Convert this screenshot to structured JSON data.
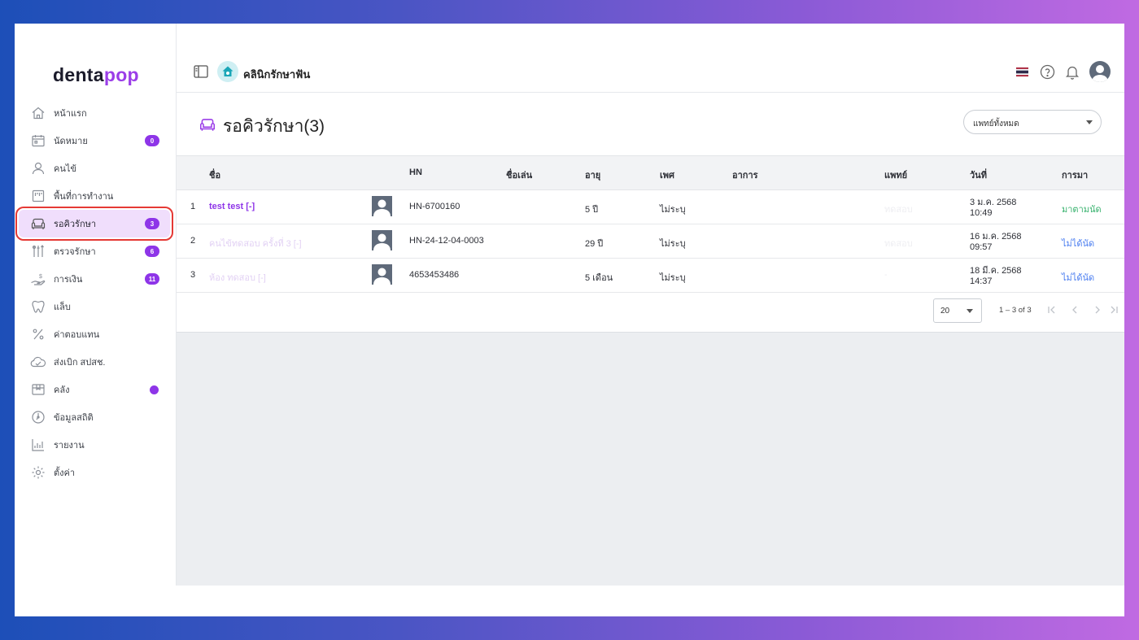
{
  "brand": {
    "part1": "denta",
    "part2": "pop"
  },
  "clinic": {
    "name": "คลินิกรักษาฟัน"
  },
  "sidebar": {
    "items": [
      {
        "label": "หน้าแรก",
        "icon": "home-icon"
      },
      {
        "label": "นัดหมาย",
        "icon": "calendar-icon",
        "badge": "0"
      },
      {
        "label": "คนไข้",
        "icon": "user-icon"
      },
      {
        "label": "พื้นที่การทำงาน",
        "icon": "workspace-icon"
      },
      {
        "label": "รอคิวรักษา",
        "icon": "sofa-icon",
        "badge": "3",
        "active": true
      },
      {
        "label": "ตรวจรักษา",
        "icon": "dental-tools-icon",
        "badge": "6"
      },
      {
        "label": "การเงิน",
        "icon": "payment-hand-icon",
        "badge": "11"
      },
      {
        "label": "แล็บ",
        "icon": "tooth-icon"
      },
      {
        "label": "ค่าตอบแทน",
        "icon": "percent-icon"
      },
      {
        "label": "ส่งเบิก สปสช.",
        "icon": "cloud-icon"
      },
      {
        "label": "คลัง",
        "icon": "box-icon",
        "dot": true
      },
      {
        "label": "ข้อมูลสถิติ",
        "icon": "gauge-icon"
      },
      {
        "label": "รายงาน",
        "icon": "chart-icon"
      },
      {
        "label": "ตั้งค่า",
        "icon": "settings-icon"
      }
    ]
  },
  "header": {
    "flag": "thai-flag-icon"
  },
  "page": {
    "title": "รอคิวรักษา(3)",
    "doctor_filter": "แพทย์ทั้งหมด"
  },
  "table": {
    "columns": {
      "name": "ชื่อ",
      "hn": "HN",
      "nickname": "ชื่อเล่น",
      "age": "อายุ",
      "sex": "เพศ",
      "symptom": "อาการ",
      "doctor": "แพทย์",
      "date": "วันที่",
      "arrival": "การมา"
    },
    "rows": [
      {
        "no": "1",
        "name": "test test [-]",
        "hn": "HN-6700160",
        "age": "5 ปี",
        "sex": "ไม่ระบุ",
        "doctor": "ทดสอบ",
        "date": "3 ม.ค. 2568",
        "time": "10:49",
        "arrival": "มาตามนัด",
        "status": "green"
      },
      {
        "no": "2",
        "name": "คนไข้ทดสอบ ครั้งที่ 3 [-]",
        "hn": "HN-24-12-04-0003",
        "age": "29 ปี",
        "sex": "ไม่ระบุ",
        "doctor": "ทดสอบ",
        "date": "16 ม.ค. 2568",
        "time": "09:57",
        "arrival": "ไม่ได้นัด",
        "status": "blue"
      },
      {
        "no": "3",
        "name": "ห้อง ทดสอบ [-]",
        "hn": "4653453486",
        "age": "5 เดือน",
        "sex": "ไม่ระบุ",
        "doctor": "-",
        "date": "18 มี.ค. 2568",
        "time": "14:37",
        "arrival": "ไม่ได้นัด",
        "status": "blue"
      }
    ]
  },
  "pagination": {
    "per_page": "20",
    "range": "1 – 3 of 3"
  },
  "colors": {
    "accent": "#8e35e8",
    "active_bg": "#f0defc",
    "highlight_border": "#e53935",
    "status_green": "#38b26e",
    "status_blue": "#4a7df0"
  }
}
